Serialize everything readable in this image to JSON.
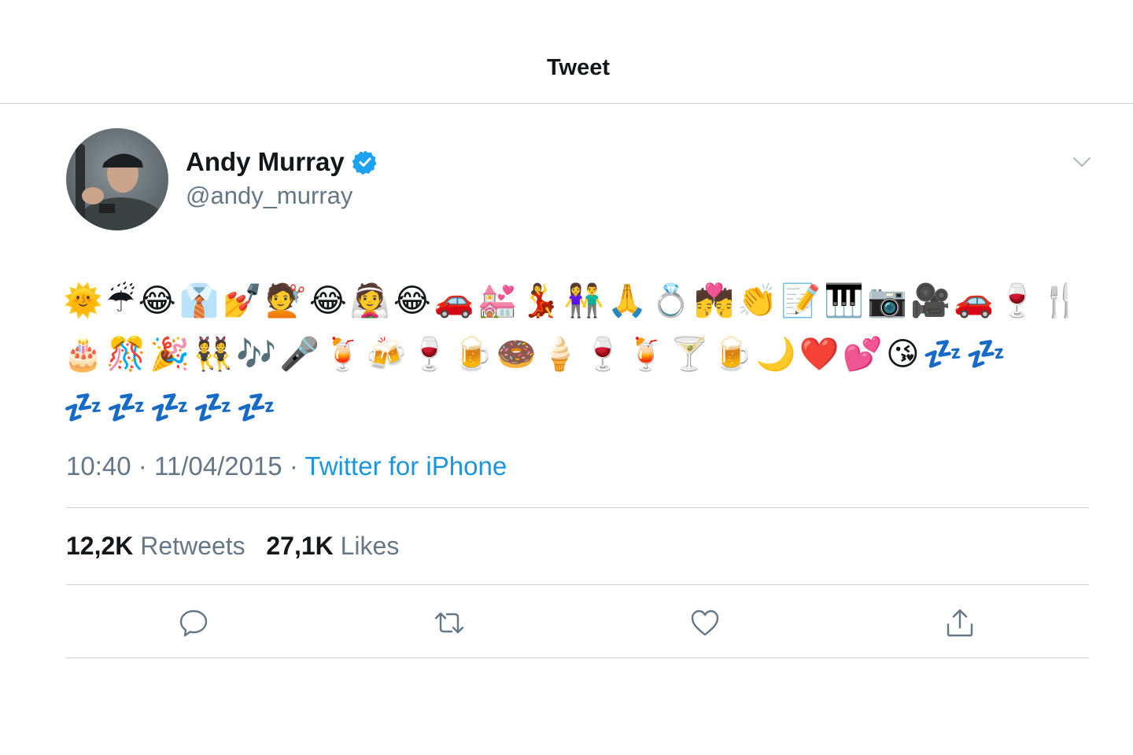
{
  "header": {
    "title": "Tweet"
  },
  "author": {
    "display_name": "Andy Murray",
    "handle": "@andy_murray",
    "verified": true
  },
  "tweet": {
    "text": "🌞☔😂👔💅💇😂👰😂🚗💒💃👫🙏💍💏👏📝🎹📷🎥🚗🍷🍴🎂🎊🎉👯🎶🎤🍹🍻🍷🍺🍩🍦🍷🍹🍸🍺🌙❤️💕😘💤💤💤💤💤💤💤",
    "time": "10:40",
    "date": "11/04/2015",
    "source": "Twitter for iPhone"
  },
  "stats": {
    "retweets_count": "12,2K",
    "retweets_label": "Retweets",
    "likes_count": "27,1K",
    "likes_label": "Likes"
  },
  "actions": [
    {
      "icon": "reply-icon"
    },
    {
      "icon": "retweet-icon"
    },
    {
      "icon": "like-icon"
    },
    {
      "icon": "share-icon"
    }
  ],
  "colors": {
    "link": "#1b95e0",
    "verified": "#1da1f2",
    "secondary_text": "#657786",
    "icon": "#657786",
    "divider": "#cfd4d9"
  }
}
